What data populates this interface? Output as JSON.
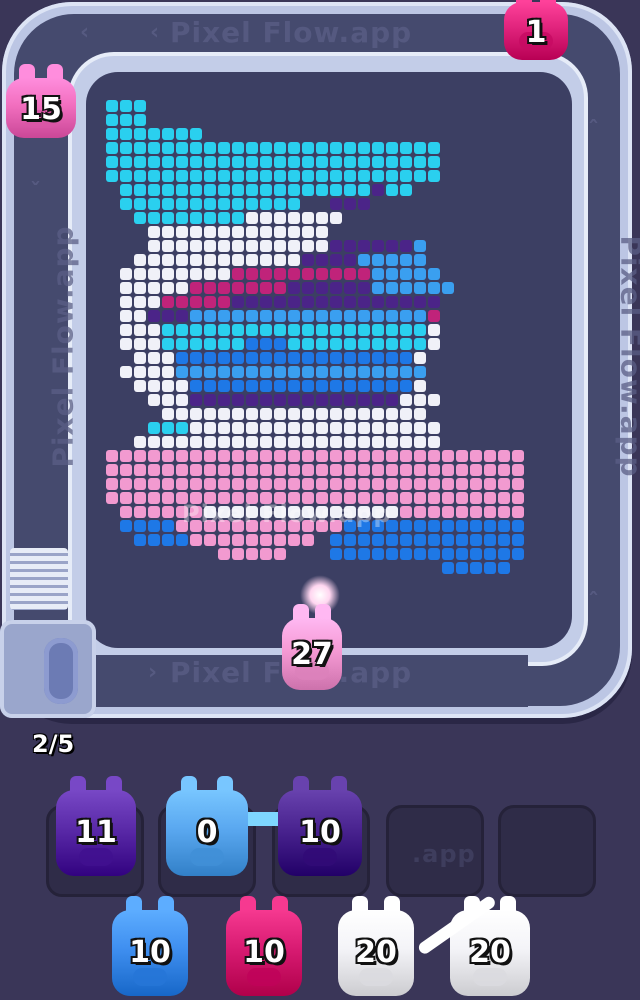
{
  "hud": {
    "counter": "2/5"
  },
  "watermarks": {
    "top": "Pixel Flow.app",
    "bottom": "Pixel Flow.app",
    "left": "Pixel Flow.app",
    "right": "Pixel Flow.app",
    "center": "Pixel Flow.app",
    "tray": ".app"
  },
  "track_pigs": [
    {
      "id": "track-pig-top-left",
      "count": "15",
      "color": "#f26fbf"
    },
    {
      "id": "track-pig-top-right",
      "count": "1",
      "color": "#e0237c"
    },
    {
      "id": "shooter-pig",
      "count": "27",
      "color": "#f59ad4"
    }
  ],
  "slot_pigs": [
    {
      "count": "11",
      "color": "#5a2aa8"
    },
    {
      "count": "0",
      "color": "#5aa8f0"
    },
    {
      "count": "10",
      "color": "#4a2490"
    }
  ],
  "queue_pigs": [
    {
      "count": "10",
      "color": "#3f8ff0"
    },
    {
      "count": "10",
      "color": "#d81b72"
    },
    {
      "count": "20",
      "color": "#f4f4f8"
    },
    {
      "count": "20",
      "color": "#f4f4f8"
    }
  ],
  "colors": {
    "cyan": "#2ad0ef",
    "white": "#f0f1f8",
    "pink": "#f29ad0",
    "blue": "#1e78e6",
    "purple": "#4b2488",
    "magenta": "#c0237a",
    "sky": "#3a9ff0"
  },
  "icons": {
    "chevrons": "chevron-left-icon",
    "launcher": "spring-launcher-icon"
  }
}
